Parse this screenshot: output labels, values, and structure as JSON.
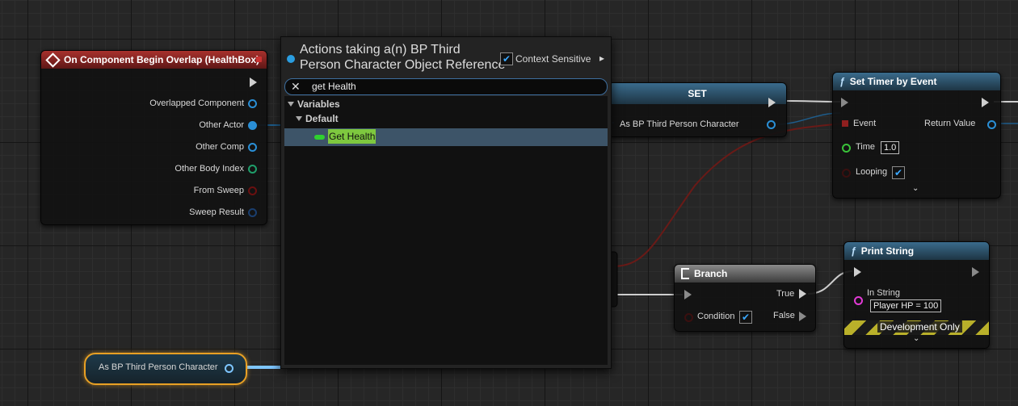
{
  "event_node": {
    "title": "On Component Begin Overlap (HealthBox)",
    "pins": [
      "Overlapped Component",
      "Other Actor",
      "Other Comp",
      "Other Body Index",
      "From Sweep",
      "Sweep Result"
    ]
  },
  "set_node": {
    "title": "SET",
    "pin_label": "As BP Third Person Character"
  },
  "timer_node": {
    "title": "Set Timer by Event",
    "event_label": "Event",
    "return_label": "Return Value",
    "time_label": "Time",
    "time_value": "1.0",
    "looping_label": "Looping",
    "looping_checked": "✔"
  },
  "branch_node": {
    "title": "Branch",
    "true_label": "True",
    "false_label": "False",
    "condition_label": "Condition",
    "condition_checked": "✔"
  },
  "print_node": {
    "title": "Print String",
    "in_string_label": "In String",
    "in_string_value": "Player HP = 100",
    "dev_only": "Development Only"
  },
  "var_node": {
    "label": "As BP Third Person Character"
  },
  "action_menu": {
    "title_line1": "Actions taking a(n) BP Third",
    "title_line2": "Person Character Object Reference",
    "context_sensitive": "Context Sensitive",
    "context_checked": "✔",
    "search_value": "get Health",
    "category": "Variables",
    "subcategory": "Default",
    "result": "Get Health"
  },
  "icons": {
    "function": "ƒ",
    "close": "✕",
    "chevron": "⌄",
    "arrow_right": "▸"
  },
  "colors": {
    "accent_blue": "#2a8fd6",
    "highlight_green": "#7ec83f",
    "event_red": "#a8312d",
    "selected_orange": "#e8a024"
  }
}
